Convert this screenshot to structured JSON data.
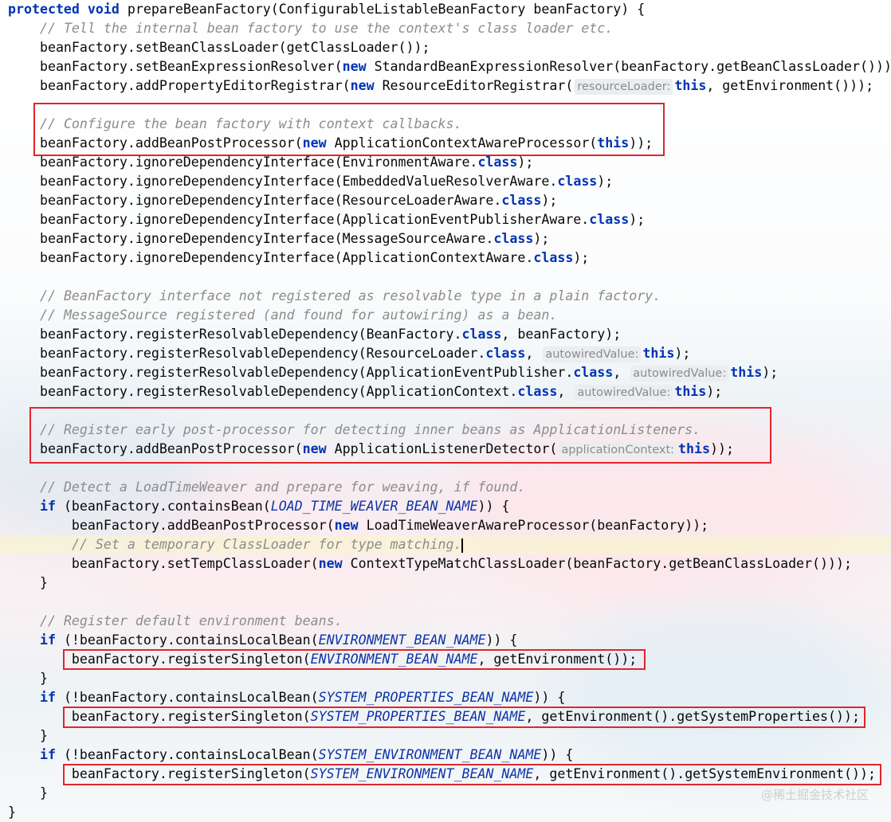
{
  "editor": {
    "lines": [
      [
        {
          "t": "protected",
          "c": "kw"
        },
        {
          "t": " "
        },
        {
          "t": "void",
          "c": "kw"
        },
        {
          "t": " prepareBeanFactory(ConfigurableListableBeanFactory beanFactory) {"
        }
      ],
      [
        {
          "t": "    "
        },
        {
          "t": "// Tell the internal bean factory to use the context's class loader etc.",
          "c": "cmt"
        }
      ],
      [
        {
          "t": "    beanFactory.setBeanClassLoader(getClassLoader());"
        }
      ],
      [
        {
          "t": "    beanFactory.setBeanExpressionResolver("
        },
        {
          "t": "new",
          "c": "kw"
        },
        {
          "t": " StandardBeanExpressionResolver(beanFactory.getBeanClassLoader()));"
        }
      ],
      [
        {
          "t": "    beanFactory.addPropertyEditorRegistrar("
        },
        {
          "t": "new",
          "c": "kw"
        },
        {
          "t": " ResourceEditorRegistrar("
        },
        {
          "t": "resourceLoader:",
          "c": "hint"
        },
        {
          "t": "this",
          "c": "kw"
        },
        {
          "t": ", getEnvironment()));"
        }
      ],
      [],
      [
        {
          "t": "    "
        },
        {
          "t": "// Configure the bean factory with context callbacks.",
          "c": "cmt"
        }
      ],
      [
        {
          "t": "    beanFactory.addBeanPostProcessor("
        },
        {
          "t": "new",
          "c": "kw"
        },
        {
          "t": " ApplicationContextAwareProcessor("
        },
        {
          "t": "this",
          "c": "kw"
        },
        {
          "t": "));"
        }
      ],
      [
        {
          "t": "    beanFactory.ignoreDependencyInterface(EnvironmentAware."
        },
        {
          "t": "class",
          "c": "kw"
        },
        {
          "t": ");"
        }
      ],
      [
        {
          "t": "    beanFactory.ignoreDependencyInterface(EmbeddedValueResolverAware."
        },
        {
          "t": "class",
          "c": "kw"
        },
        {
          "t": ");"
        }
      ],
      [
        {
          "t": "    beanFactory.ignoreDependencyInterface(ResourceLoaderAware."
        },
        {
          "t": "class",
          "c": "kw"
        },
        {
          "t": ");"
        }
      ],
      [
        {
          "t": "    beanFactory.ignoreDependencyInterface(ApplicationEventPublisherAware."
        },
        {
          "t": "class",
          "c": "kw"
        },
        {
          "t": ");"
        }
      ],
      [
        {
          "t": "    beanFactory.ignoreDependencyInterface(MessageSourceAware."
        },
        {
          "t": "class",
          "c": "kw"
        },
        {
          "t": ");"
        }
      ],
      [
        {
          "t": "    beanFactory.ignoreDependencyInterface(ApplicationContextAware."
        },
        {
          "t": "class",
          "c": "kw"
        },
        {
          "t": ");"
        }
      ],
      [],
      [
        {
          "t": "    "
        },
        {
          "t": "// BeanFactory interface not registered as resolvable type in a plain factory.",
          "c": "cmt"
        }
      ],
      [
        {
          "t": "    "
        },
        {
          "t": "// MessageSource registered (and found for autowiring) as a bean.",
          "c": "cmt"
        }
      ],
      [
        {
          "t": "    beanFactory.registerResolvableDependency(BeanFactory."
        },
        {
          "t": "class",
          "c": "kw"
        },
        {
          "t": ", beanFactory);"
        }
      ],
      [
        {
          "t": "    beanFactory.registerResolvableDependency(ResourceLoader."
        },
        {
          "t": "class",
          "c": "kw"
        },
        {
          "t": ", "
        },
        {
          "t": "autowiredValue:",
          "c": "hint"
        },
        {
          "t": "this",
          "c": "kw"
        },
        {
          "t": ");"
        }
      ],
      [
        {
          "t": "    beanFactory.registerResolvableDependency(ApplicationEventPublisher."
        },
        {
          "t": "class",
          "c": "kw"
        },
        {
          "t": ", "
        },
        {
          "t": "autowiredValue:",
          "c": "hint"
        },
        {
          "t": "this",
          "c": "kw"
        },
        {
          "t": ");"
        }
      ],
      [
        {
          "t": "    beanFactory.registerResolvableDependency(ApplicationContext."
        },
        {
          "t": "class",
          "c": "kw"
        },
        {
          "t": ", "
        },
        {
          "t": "autowiredValue:",
          "c": "hint"
        },
        {
          "t": "this",
          "c": "kw"
        },
        {
          "t": ");"
        }
      ],
      [],
      [
        {
          "t": "    "
        },
        {
          "t": "// Register early post-processor for detecting inner beans as ApplicationListeners.",
          "c": "cmt"
        }
      ],
      [
        {
          "t": "    beanFactory.addBeanPostProcessor("
        },
        {
          "t": "new",
          "c": "kw"
        },
        {
          "t": " ApplicationListenerDetector("
        },
        {
          "t": "applicationContext:",
          "c": "hint"
        },
        {
          "t": "this",
          "c": "kw"
        },
        {
          "t": "));"
        }
      ],
      [],
      [
        {
          "t": "    "
        },
        {
          "t": "// Detect a LoadTimeWeaver and prepare for weaving, if found.",
          "c": "cmt"
        }
      ],
      [
        {
          "t": "    "
        },
        {
          "t": "if",
          "c": "kw"
        },
        {
          "t": " (beanFactory.containsBean("
        },
        {
          "t": "LOAD_TIME_WEAVER_BEAN_NAME",
          "c": "const2"
        },
        {
          "t": ")) {"
        }
      ],
      [
        {
          "t": "        beanFactory.addBeanPostProcessor("
        },
        {
          "t": "new",
          "c": "kw"
        },
        {
          "t": " LoadTimeWeaverAwareProcessor(beanFactory));"
        }
      ],
      [
        {
          "t": "        "
        },
        {
          "t": "// Set a temporary ClassLoader for type matching.",
          "c": "cmt"
        },
        {
          "t": "",
          "c": "caret"
        }
      ],
      [
        {
          "t": "        beanFactory.setTempClassLoader("
        },
        {
          "t": "new",
          "c": "kw"
        },
        {
          "t": " ContextTypeMatchClassLoader(beanFactory.getBeanClassLoader()));"
        }
      ],
      [
        {
          "t": "    }"
        }
      ],
      [],
      [
        {
          "t": "    "
        },
        {
          "t": "// Register default environment beans.",
          "c": "cmt"
        }
      ],
      [
        {
          "t": "    "
        },
        {
          "t": "if",
          "c": "kw"
        },
        {
          "t": " (!beanFactory.containsLocalBean("
        },
        {
          "t": "ENVIRONMENT_BEAN_NAME",
          "c": "const2"
        },
        {
          "t": ")) {"
        }
      ],
      [
        {
          "t": "        beanFactory.registerSingleton("
        },
        {
          "t": "ENVIRONMENT_BEAN_NAME",
          "c": "const2"
        },
        {
          "t": ", getEnvironment());"
        }
      ],
      [
        {
          "t": "    }"
        }
      ],
      [
        {
          "t": "    "
        },
        {
          "t": "if",
          "c": "kw"
        },
        {
          "t": " (!beanFactory.containsLocalBean("
        },
        {
          "t": "SYSTEM_PROPERTIES_BEAN_NAME",
          "c": "const2"
        },
        {
          "t": ")) {"
        }
      ],
      [
        {
          "t": "        beanFactory.registerSingleton("
        },
        {
          "t": "SYSTEM_PROPERTIES_BEAN_NAME",
          "c": "const2"
        },
        {
          "t": ", getEnvironment().getSystemProperties());"
        }
      ],
      [
        {
          "t": "    }"
        }
      ],
      [
        {
          "t": "    "
        },
        {
          "t": "if",
          "c": "kw"
        },
        {
          "t": " (!beanFactory.containsLocalBean("
        },
        {
          "t": "SYSTEM_ENVIRONMENT_BEAN_NAME",
          "c": "const2"
        },
        {
          "t": ")) {"
        }
      ],
      [
        {
          "t": "        beanFactory.registerSingleton("
        },
        {
          "t": "SYSTEM_ENVIRONMENT_BEAN_NAME",
          "c": "const2"
        },
        {
          "t": ", getEnvironment().getSystemEnvironment());"
        }
      ],
      [
        {
          "t": "    }"
        }
      ],
      [
        {
          "t": "}"
        }
      ]
    ],
    "current_line": 28
  },
  "watermark": "@稀土掘金技术社区",
  "colors": {
    "keyword": "#0033b3",
    "comment": "#8c8c8c",
    "constant": "#0d34a8",
    "highlight_box": "#e0262b",
    "current_line": "#faf5c8"
  }
}
